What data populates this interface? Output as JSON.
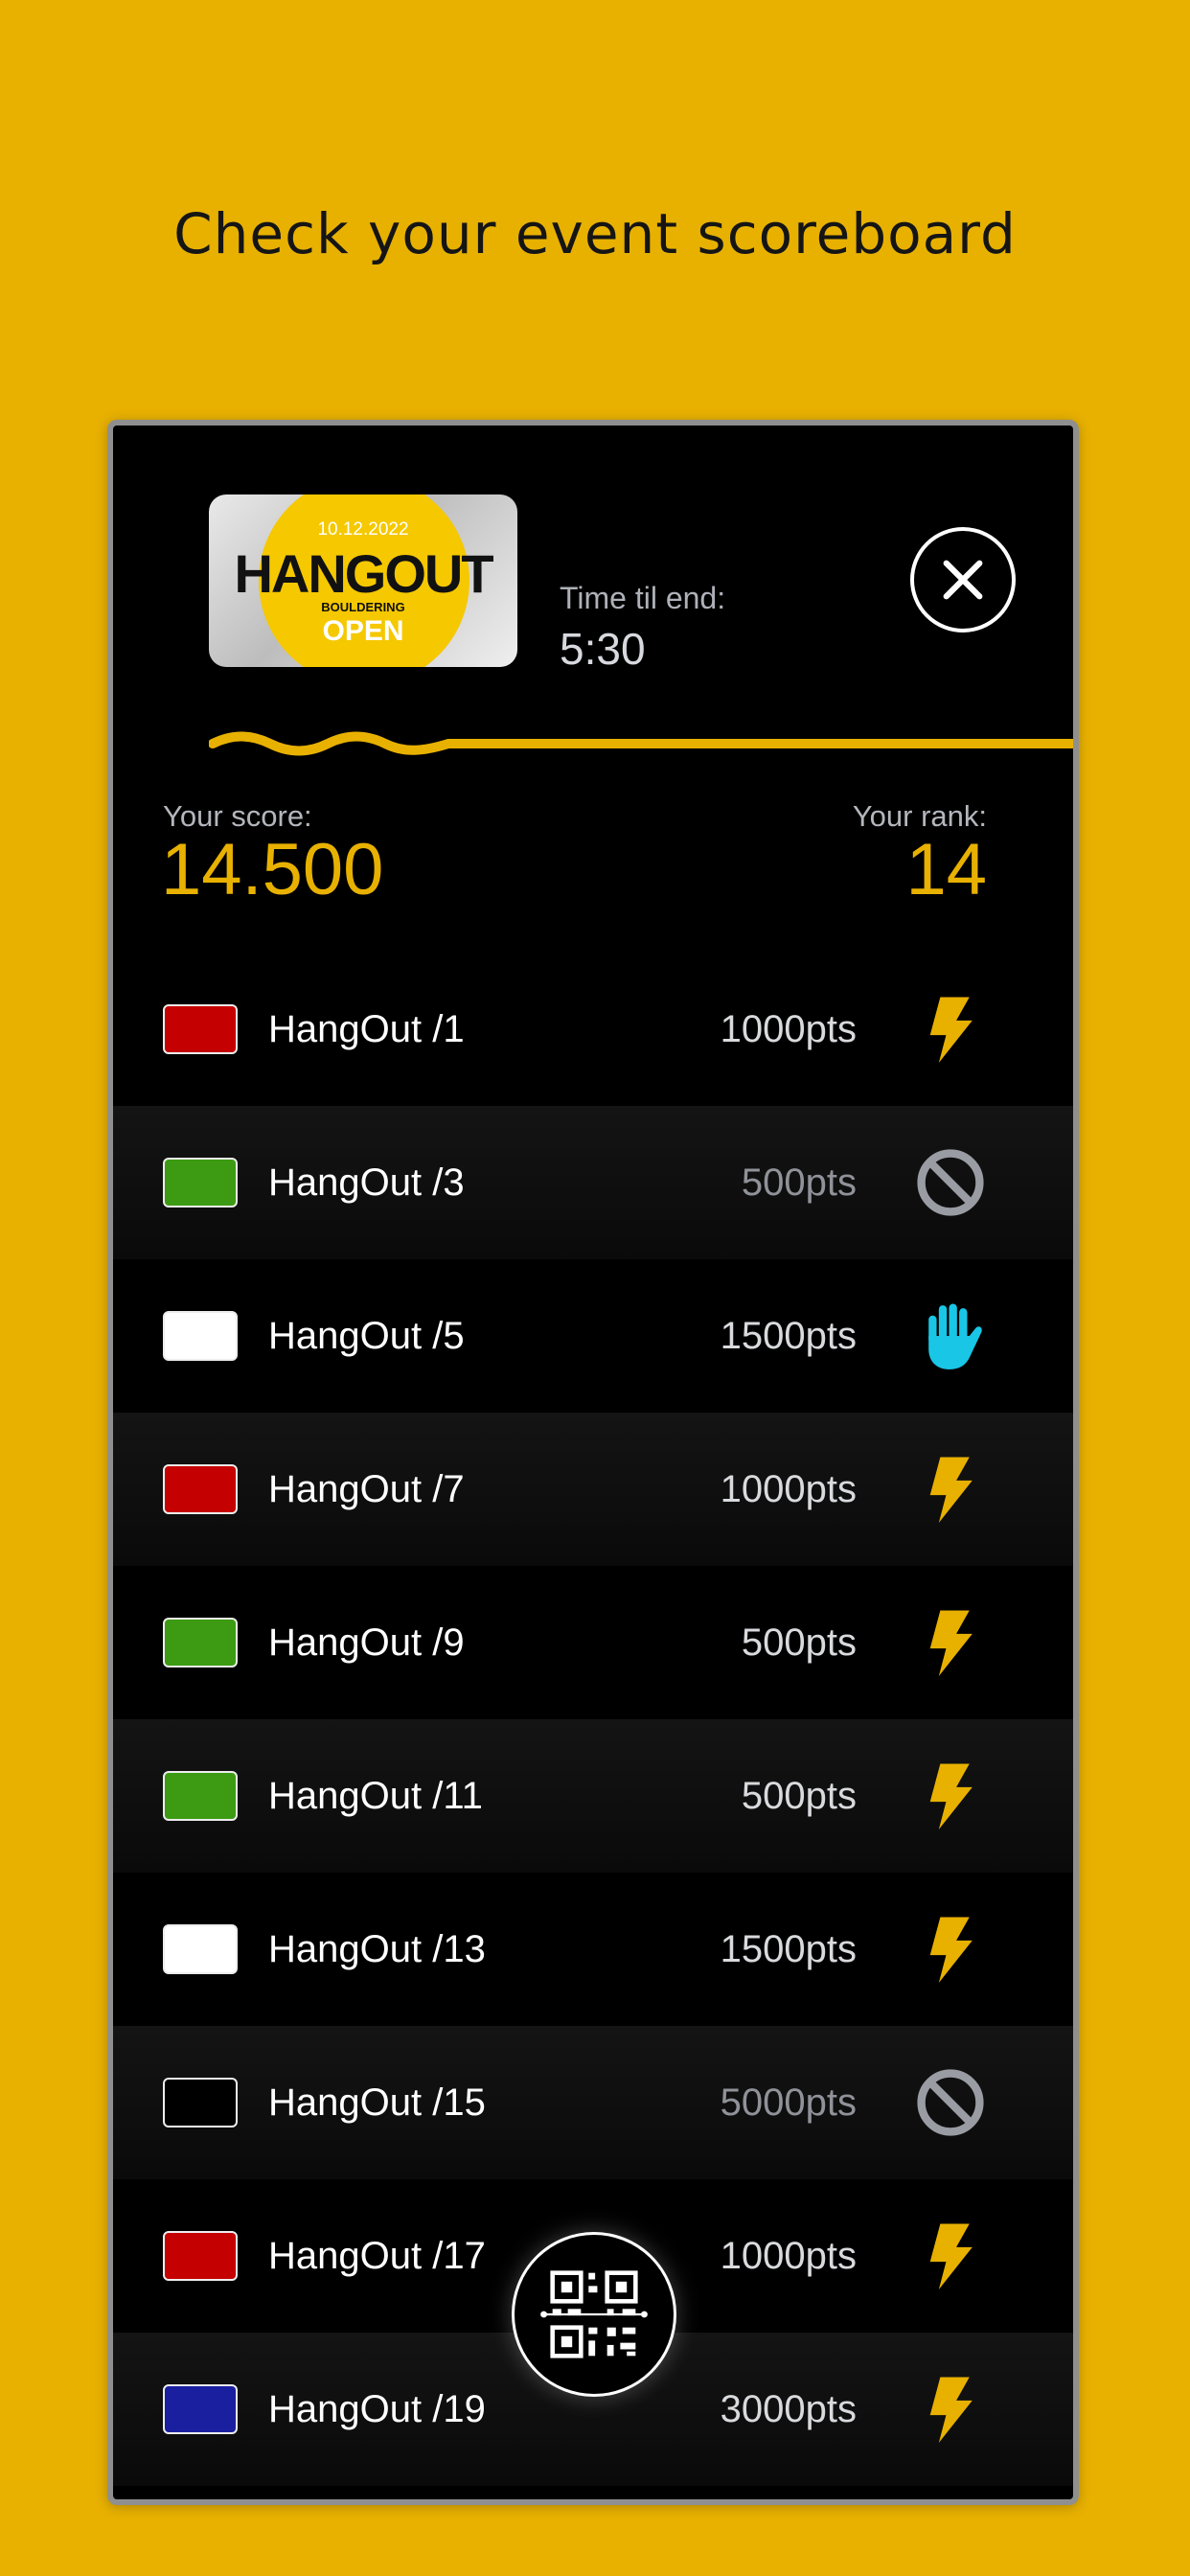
{
  "headline": "Check your event scoreboard",
  "event": {
    "thumbnail": {
      "date": "10.12.2022",
      "title": "HANGOUT",
      "subtitle": "BOULDERING",
      "badge": "OPEN"
    },
    "time_label": "Time til end:",
    "time_value": "5:30",
    "close_icon": "close-icon"
  },
  "stats": {
    "score_label": "Your score:",
    "score_value": "14.500",
    "rank_label": "Your rank:",
    "rank_value": "14"
  },
  "colors": {
    "accent": "#E8B100",
    "background": "#000000",
    "flash": "#E8B100",
    "attempt": "#19C6E6",
    "not_done": "#9A9CA3"
  },
  "problems": [
    {
      "name": "HangOut /1",
      "points": "1000pts",
      "color": "#C40000",
      "status": "flash",
      "dim": false
    },
    {
      "name": "HangOut /3",
      "points": "500pts",
      "color": "#3C9B12",
      "status": "not-done",
      "dim": true
    },
    {
      "name": "HangOut /5",
      "points": "1500pts",
      "color": "#FFFFFF",
      "status": "attempt",
      "dim": false
    },
    {
      "name": "HangOut /7",
      "points": "1000pts",
      "color": "#C40000",
      "status": "flash",
      "dim": false
    },
    {
      "name": "HangOut /9",
      "points": "500pts",
      "color": "#3C9B12",
      "status": "flash",
      "dim": false
    },
    {
      "name": "HangOut /11",
      "points": "500pts",
      "color": "#3C9B12",
      "status": "flash",
      "dim": false
    },
    {
      "name": "HangOut /13",
      "points": "1500pts",
      "color": "#FFFFFF",
      "status": "flash",
      "dim": false
    },
    {
      "name": "HangOut /15",
      "points": "5000pts",
      "color": "#000000",
      "status": "not-done",
      "dim": true
    },
    {
      "name": "HangOut /17",
      "points": "1000pts",
      "color": "#C40000",
      "status": "flash",
      "dim": false
    },
    {
      "name": "HangOut /19",
      "points": "3000pts",
      "color": "#1A1FA0",
      "status": "flash",
      "dim": false
    }
  ],
  "scan_button_icon": "qr-code-icon"
}
